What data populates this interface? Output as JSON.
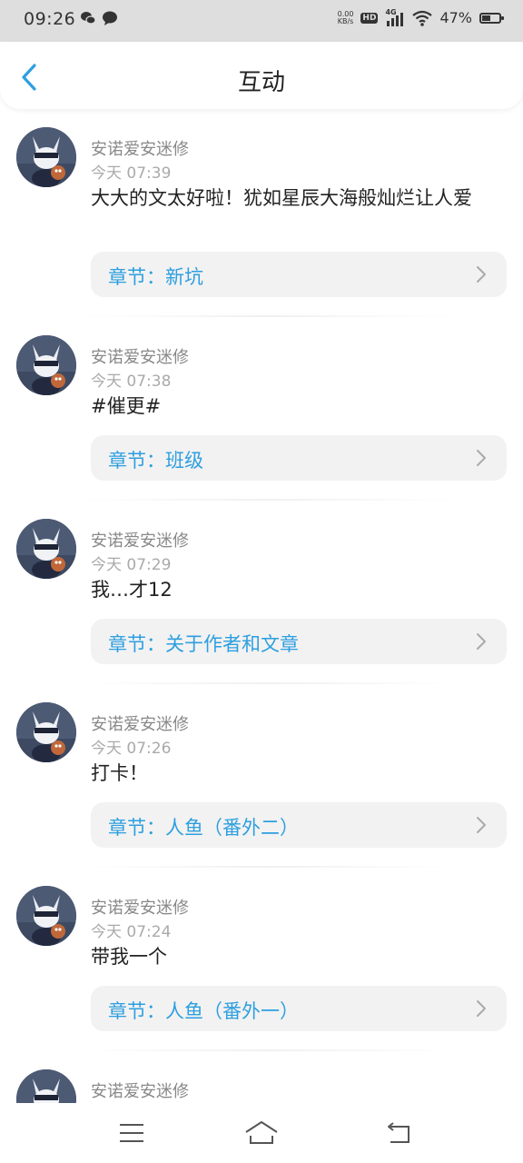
{
  "status_bar": {
    "time": "09:26",
    "net_speed_value": "0.00",
    "net_speed_unit": "KB/s",
    "hd_label": "HD",
    "network_label": "4G",
    "battery_percent_text": "47%",
    "battery_level": 0.47,
    "icons": [
      "wechat-icon",
      "chat-bubble-icon",
      "hd-icon",
      "signal-icon",
      "wifi-icon",
      "battery-icon"
    ]
  },
  "header": {
    "title": "互动",
    "back_icon": "chevron-left-icon"
  },
  "colors": {
    "accent": "#2d9fe0",
    "text": "#222222",
    "muted": "#888888",
    "chip_bg": "#f2f2f2"
  },
  "comments": [
    {
      "username": "安诺爱安迷修",
      "time": "今天 07:39",
      "text": "大大的文太好啦！犹如星辰大海般灿烂让人爱",
      "chapter": "章节：新坑"
    },
    {
      "username": "安诺爱安迷修",
      "time": "今天 07:38",
      "text": "#催更#",
      "chapter": "章节：班级"
    },
    {
      "username": "安诺爱安迷修",
      "time": "今天 07:29",
      "text": "我…才12",
      "chapter": "章节：关于作者和文章"
    },
    {
      "username": "安诺爱安迷修",
      "time": "今天 07:26",
      "text": "打卡！",
      "chapter": "章节：人鱼（番外二）"
    },
    {
      "username": "安诺爱安迷修",
      "time": "今天 07:24",
      "text": "带我一个",
      "chapter": "章节：人鱼（番外一）"
    },
    {
      "username": "安诺爱安迷修"
    }
  ],
  "nav_bar": {
    "icons": [
      "menu-icon",
      "home-icon",
      "back-icon"
    ]
  }
}
